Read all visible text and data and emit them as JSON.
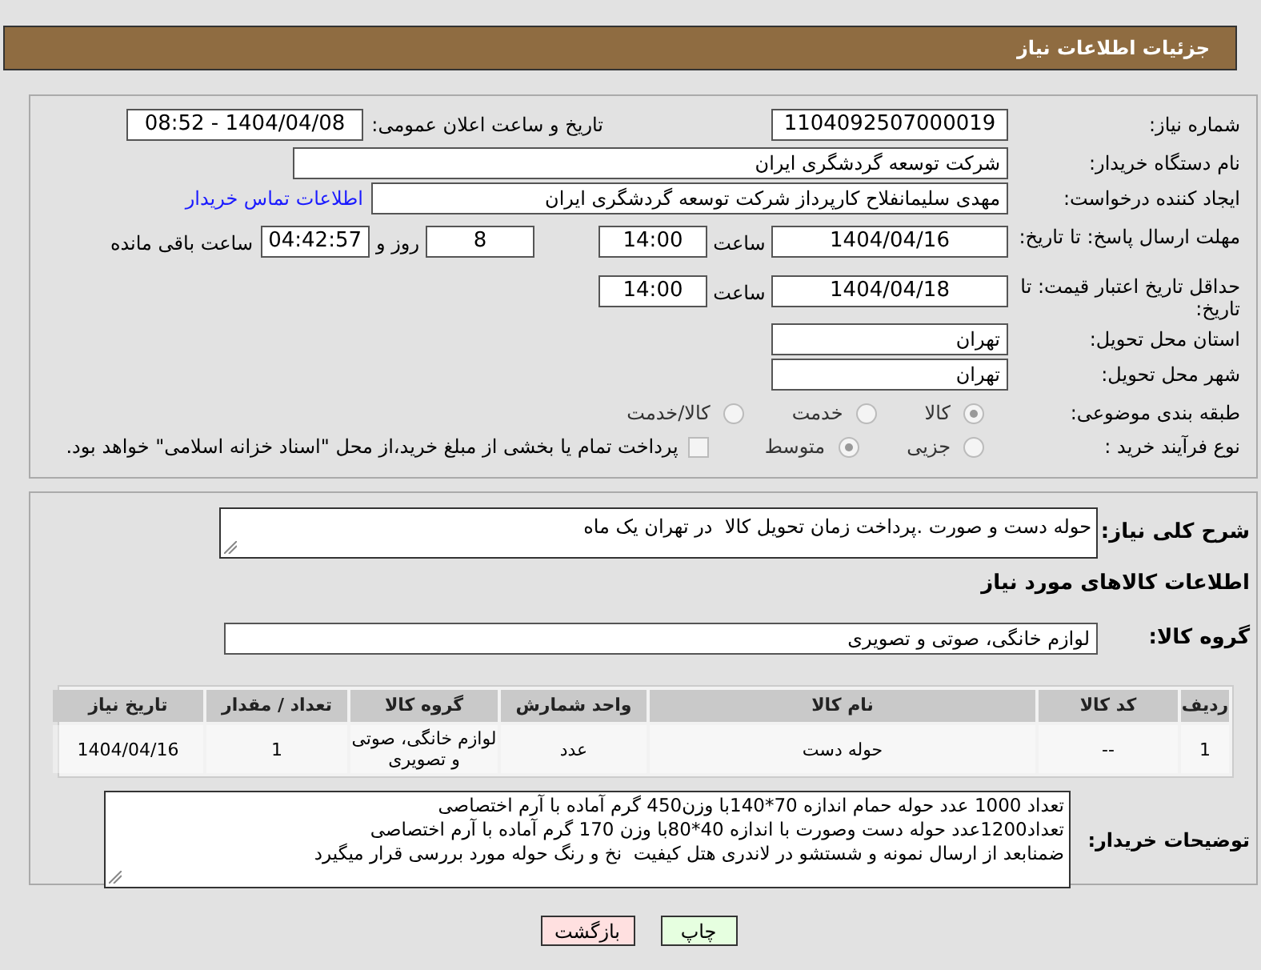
{
  "header": {
    "title": "جزئیات اطلاعات نیاز"
  },
  "need_number": {
    "label": "شماره نیاز:",
    "value": "1104092507000019"
  },
  "announce": {
    "label": "تاریخ و ساعت اعلان عمومی:",
    "value": "1404/04/08 - 08:52"
  },
  "buyer_org": {
    "label": "نام دستگاه خریدار:",
    "value": "شرکت توسعه گردشگری ایران"
  },
  "requester": {
    "label": "ایجاد کننده درخواست:",
    "value": "مهدی سلیمانفلاح کارپرداز شرکت توسعه گردشگری ایران",
    "contact_link": "اطلاعات تماس خریدار"
  },
  "response_deadline": {
    "label": "مهلت ارسال پاسخ: تا تاریخ:",
    "date": "1404/04/16",
    "time_label": "ساعت",
    "time": "14:00",
    "days": "8",
    "days_label": "روز و",
    "remaining": "04:42:57",
    "remaining_label": "ساعت باقی مانده"
  },
  "price_validity": {
    "label": "حداقل تاریخ اعتبار قیمت: تا تاریخ:",
    "date": "1404/04/18",
    "time_label": "ساعت",
    "time": "14:00"
  },
  "province": {
    "label": "استان محل تحویل:",
    "value": "تهران"
  },
  "city": {
    "label": "شهر محل تحویل:",
    "value": "تهران"
  },
  "category": {
    "label": "طبقه بندی موضوعی:",
    "options": [
      {
        "label": "کالا",
        "selected": true
      },
      {
        "label": "خدمت",
        "selected": false
      },
      {
        "label": "کالا/خدمت",
        "selected": false
      }
    ]
  },
  "purchase_type": {
    "label": "نوع فرآیند خرید :",
    "options": [
      {
        "label": "جزیی",
        "selected": false
      },
      {
        "label": "متوسط",
        "selected": true
      }
    ],
    "payment_note": {
      "checked": false,
      "text": "پرداخت تمام یا بخشی از مبلغ خرید،از محل \"اسناد خزانه اسلامی\" خواهد بود."
    }
  },
  "description": {
    "label": "شرح کلی نیاز:",
    "value": "حوله دست و صورت .پرداخت زمان تحویل کالا  در تهران یک ماه"
  },
  "items_heading": "اطلاعات کالاهای مورد نیاز",
  "goods_group": {
    "label": "گروه کالا:",
    "value": "لوازم خانگی، صوتی و تصویری"
  },
  "table": {
    "columns": [
      "ردیف",
      "کد کالا",
      "نام کالا",
      "واحد شمارش",
      "گروه کالا",
      "تعداد / مقدار",
      "تاریخ نیاز"
    ],
    "rows": [
      [
        "1",
        "--",
        "حوله دست",
        "عدد",
        "لوازم خانگی، صوتی و تصویری",
        "1",
        "1404/04/16"
      ]
    ]
  },
  "buyer_notes": {
    "label": "توضیحات خریدار:",
    "lines": [
      "تعداد 1000 عدد حوله حمام اندازه 70*140با وزن450 گرم آماده با آرم اختصاصی",
      "تعداد1200عدد حوله دست وصورت با اندازه 40*80با وزن 170 گرم آماده با آرم اختصاصی",
      "ضمنابعد از ارسال نمونه و شستشو در لاندری هتل کیفیت  نخ و رنگ حوله مورد بررسی قرار میگیرد"
    ]
  },
  "buttons": [
    {
      "label": "چاپ",
      "kind": "print"
    },
    {
      "label": "بازگشت",
      "kind": "back"
    }
  ]
}
